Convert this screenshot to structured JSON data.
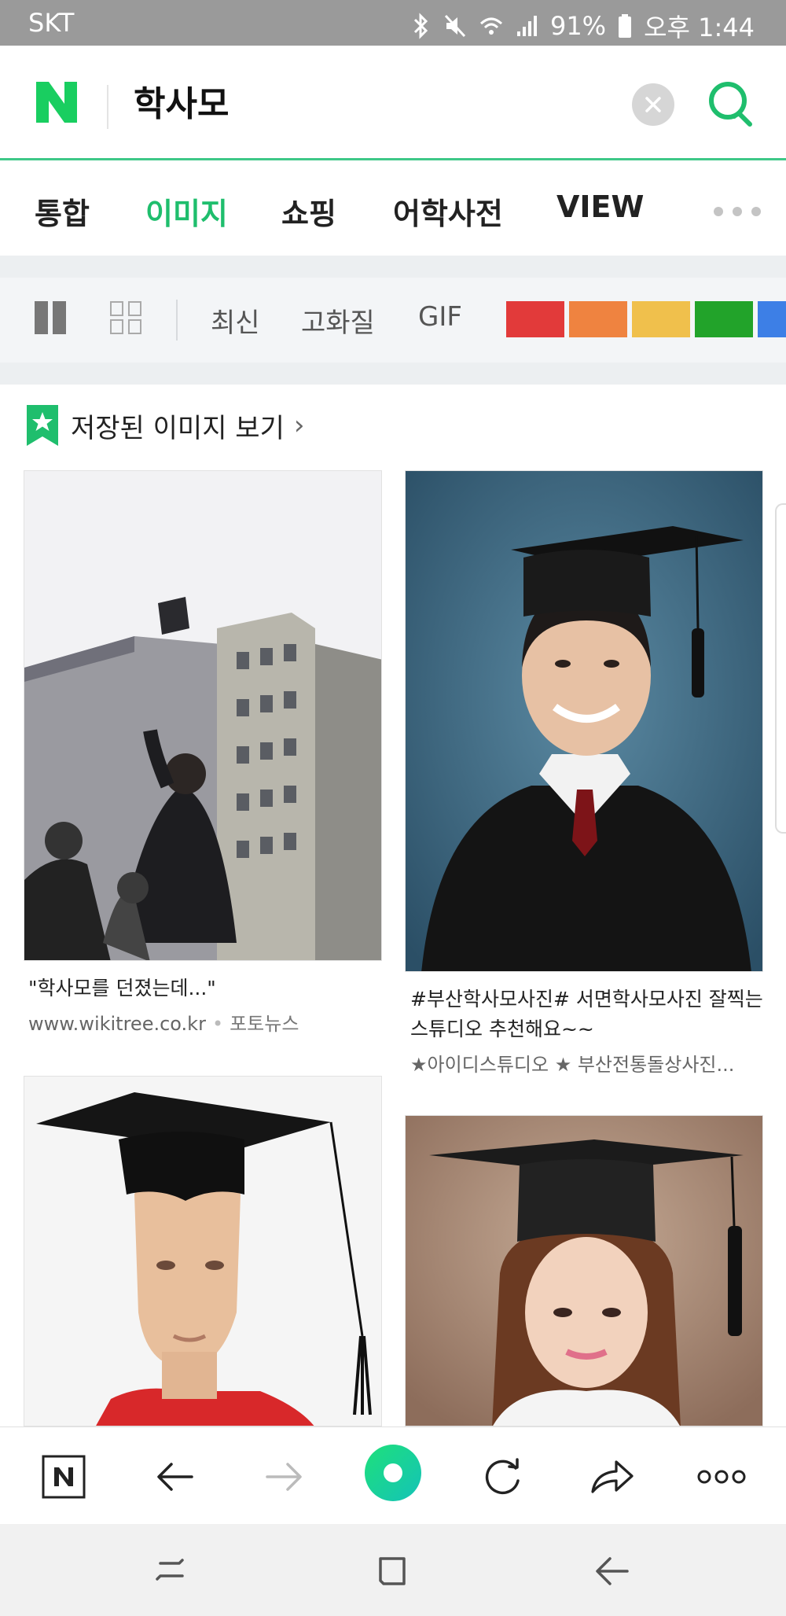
{
  "status_bar": {
    "carrier": "SKT",
    "battery": "91%",
    "time": "오후 1:44"
  },
  "search": {
    "logo": "N",
    "query": "학사모"
  },
  "tabs": [
    {
      "label": "통합",
      "active": false
    },
    {
      "label": "이미지",
      "active": true
    },
    {
      "label": "쇼핑",
      "active": false
    },
    {
      "label": "어학사전",
      "active": false
    },
    {
      "label": "VIEW",
      "active": false
    }
  ],
  "filters": {
    "options": [
      "최신",
      "고화질",
      "GIF"
    ],
    "colors": [
      "#e23a3a",
      "#ef8340",
      "#f0c04c",
      "#22a32a",
      "#3d7fe6"
    ]
  },
  "saved_images_label": "저장된 이미지 보기",
  "results": [
    {
      "title": "\"학사모를 던졌는데...\"",
      "source": "www.wikitree.co.kr",
      "press": "포토뉴스"
    },
    {
      "title": "#부산학사모사진# 서면학사모사진 잘찍는스튜디오 추천해요~~",
      "source": "★아이디스튜디오 ★ 부산전통돌상사진..."
    }
  ],
  "icons": {
    "bluetooth": "bluetooth-icon",
    "mute": "mute-icon",
    "wifi": "wifi-icon",
    "signal": "signal-icon",
    "battery": "battery-icon",
    "clear": "clear-icon",
    "search": "search-icon",
    "back": "back-arrow-icon",
    "forward": "forward-arrow-icon",
    "reload": "reload-icon",
    "share": "share-icon",
    "more": "more-icon"
  },
  "accent_color": "#1fbe6d"
}
